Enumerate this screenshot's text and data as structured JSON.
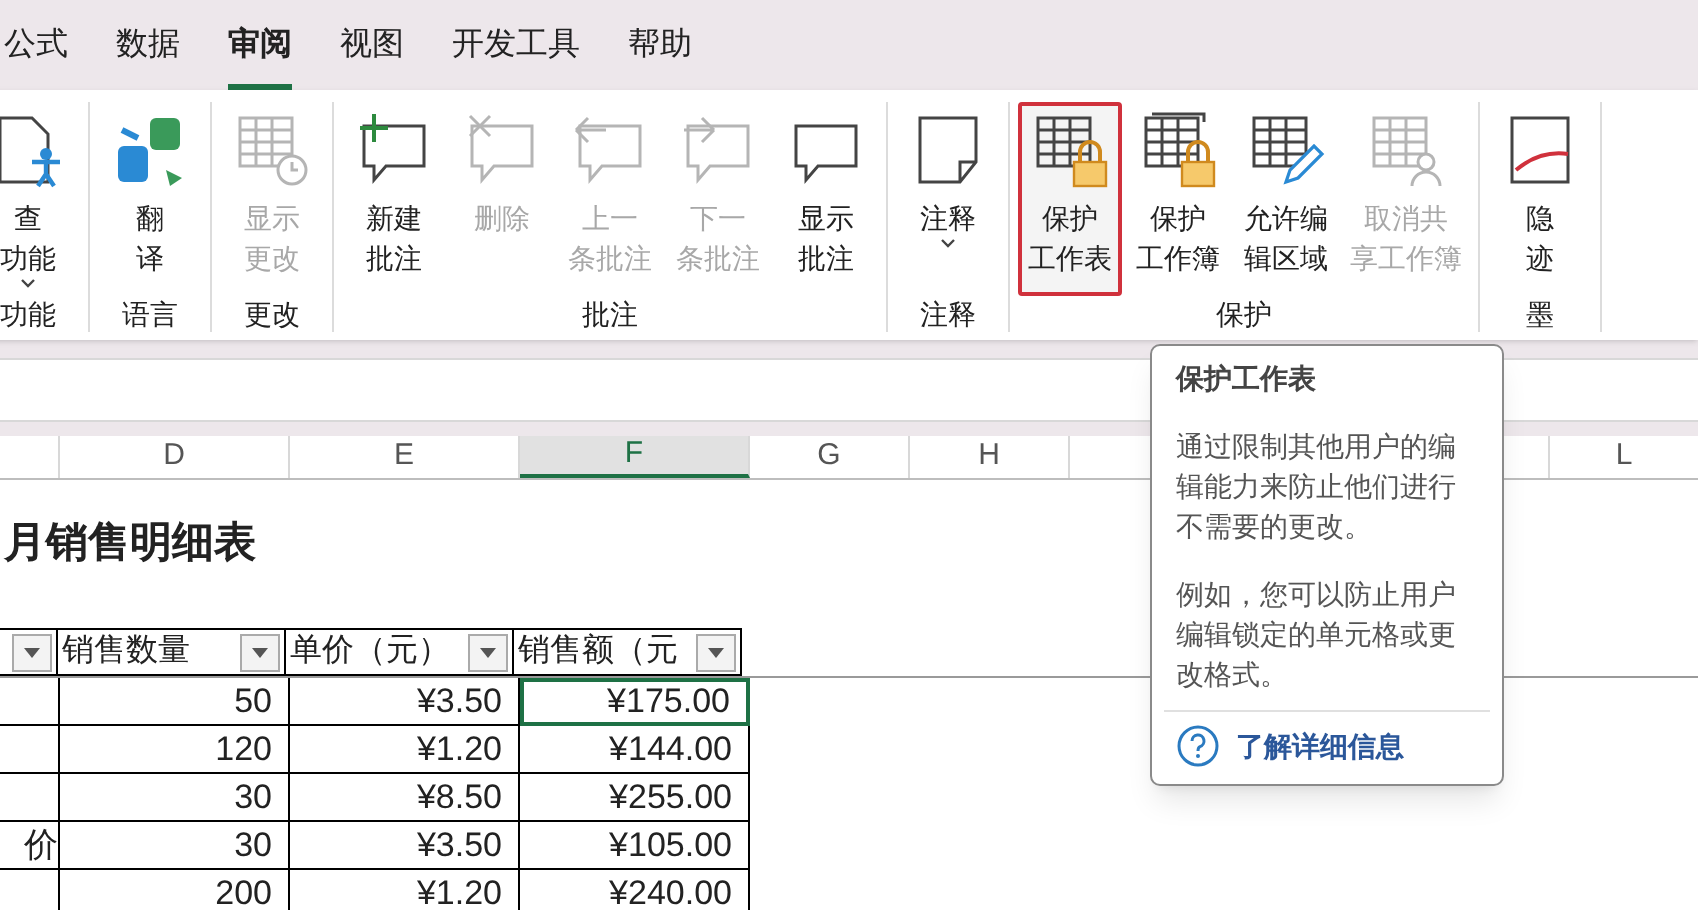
{
  "ribbon_tabs": [
    {
      "label": "公式",
      "selected": false
    },
    {
      "label": "数据",
      "selected": false
    },
    {
      "label": "审阅",
      "selected": true
    },
    {
      "label": "视图",
      "selected": false
    },
    {
      "label": "开发工具",
      "selected": false
    },
    {
      "label": "帮助",
      "selected": false
    }
  ],
  "ribbon_groups": [
    {
      "label": "功能",
      "buttons": [
        {
          "kind": "accessibility",
          "lines": [
            "查",
            "功能"
          ],
          "dropdown": true,
          "disabled": false,
          "highlighted": false
        }
      ]
    },
    {
      "label": "语言",
      "buttons": [
        {
          "kind": "translate",
          "lines": [
            "翻",
            "译"
          ],
          "dropdown": false,
          "disabled": false,
          "highlighted": false
        }
      ]
    },
    {
      "label": "更改",
      "buttons": [
        {
          "kind": "changes",
          "lines": [
            "显示",
            "更改"
          ],
          "dropdown": false,
          "disabled": true,
          "highlighted": false
        }
      ]
    },
    {
      "label": "批注",
      "buttons": [
        {
          "kind": "new-comment",
          "lines": [
            "新建",
            "批注"
          ],
          "dropdown": false,
          "disabled": false,
          "highlighted": false
        },
        {
          "kind": "delete-comment",
          "lines": [
            "删除"
          ],
          "dropdown": false,
          "disabled": true,
          "highlighted": false
        },
        {
          "kind": "prev-comment",
          "lines": [
            "上一",
            "条批注"
          ],
          "dropdown": false,
          "disabled": true,
          "highlighted": false
        },
        {
          "kind": "next-comment",
          "lines": [
            "下一",
            "条批注"
          ],
          "dropdown": false,
          "disabled": true,
          "highlighted": false
        },
        {
          "kind": "comment",
          "lines": [
            "显示",
            "批注"
          ],
          "dropdown": false,
          "disabled": false,
          "highlighted": false
        }
      ]
    },
    {
      "label": "注释",
      "buttons": [
        {
          "kind": "note",
          "lines": [
            "注释"
          ],
          "dropdown": true,
          "disabled": false,
          "highlighted": false
        }
      ]
    },
    {
      "label": "保护",
      "buttons": [
        {
          "kind": "protect-sheet",
          "lines": [
            "保护",
            "工作表"
          ],
          "dropdown": false,
          "disabled": false,
          "highlighted": true
        },
        {
          "kind": "protect-workbook",
          "lines": [
            "保护",
            "工作簿"
          ],
          "dropdown": false,
          "disabled": false,
          "highlighted": false
        },
        {
          "kind": "allow-edit",
          "lines": [
            "允许编",
            "辑区域"
          ],
          "dropdown": false,
          "disabled": false,
          "highlighted": false
        },
        {
          "kind": "unshare",
          "lines": [
            "取消共",
            "享工作簿"
          ],
          "dropdown": false,
          "disabled": true,
          "highlighted": false
        }
      ]
    },
    {
      "label": "墨",
      "buttons": [
        {
          "kind": "ink",
          "lines": [
            "隐",
            "迹"
          ],
          "dropdown": false,
          "disabled": false,
          "highlighted": false
        }
      ]
    }
  ],
  "column_headers": [
    {
      "label": "D",
      "selected": false
    },
    {
      "label": "E",
      "selected": false
    },
    {
      "label": "F",
      "selected": true
    },
    {
      "label": "G",
      "selected": false
    },
    {
      "label": "H",
      "selected": false
    },
    {
      "label": "L",
      "selected": false
    }
  ],
  "sheet_title": "月销售明细表",
  "table": {
    "columns": [
      {
        "filter": true
      },
      {
        "label": "销售数量",
        "filter": true
      },
      {
        "label": "单价（元）",
        "filter": true
      },
      {
        "label": "销售额（元",
        "filter": true
      }
    ],
    "rows": [
      {
        "cells": [
          {
            "text": "50",
            "selected": false
          },
          {
            "text": "¥3.50",
            "selected": false
          },
          {
            "text": "¥175.00",
            "selected": true
          }
        ]
      },
      {
        "cells": [
          {
            "text": "120",
            "selected": false
          },
          {
            "text": "¥1.20",
            "selected": false
          },
          {
            "text": "¥144.00",
            "selected": false
          }
        ]
      },
      {
        "cells": [
          {
            "text": "30",
            "selected": false
          },
          {
            "text": "¥8.50",
            "selected": false
          },
          {
            "text": "¥255.00",
            "selected": false
          }
        ]
      },
      {
        "lead": "价",
        "cells": [
          {
            "text": "30",
            "selected": false
          },
          {
            "text": "¥3.50",
            "selected": false
          },
          {
            "text": "¥105.00",
            "selected": false
          }
        ]
      },
      {
        "cells": [
          {
            "text": "200",
            "selected": false
          },
          {
            "text": "¥1.20",
            "selected": false
          },
          {
            "text": "¥240.00",
            "selected": false
          }
        ]
      }
    ]
  },
  "tooltip": {
    "title": "保护工作表",
    "paragraphs": [
      "通过限制其他用户的编辑能力来防止他们进行不需要的更改。",
      "例如，您可以防止用户编辑锁定的单元格或更改格式。"
    ],
    "link": "了解详细信息"
  }
}
